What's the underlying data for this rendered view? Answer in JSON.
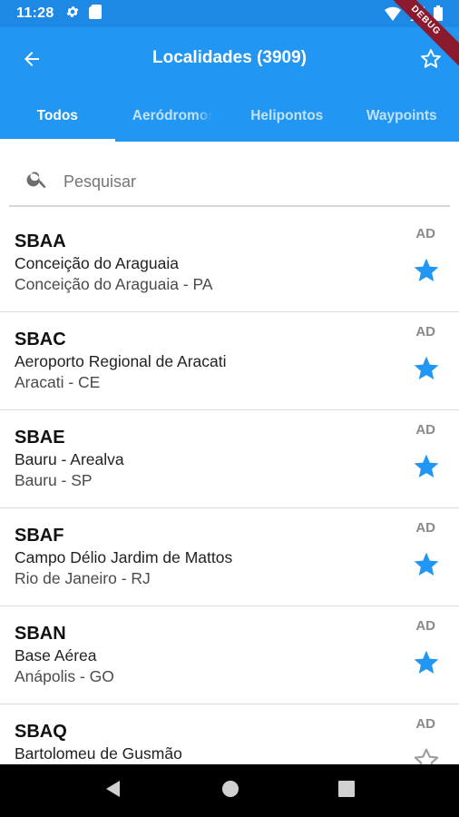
{
  "status_bar": {
    "time": "11:28",
    "debug_label": "DEBUG"
  },
  "app_bar": {
    "title": "Localidades (3909)"
  },
  "tabs": [
    {
      "label": "Todos",
      "active": true
    },
    {
      "label": "Aeródromos",
      "active": false
    },
    {
      "label": "Helipontos",
      "active": false
    },
    {
      "label": "Waypoints",
      "active": false
    }
  ],
  "search": {
    "placeholder": "Pesquisar",
    "value": ""
  },
  "locations": [
    {
      "code": "SBAA",
      "name": "Conceição do Araguaia",
      "city": "Conceição do Araguaia - PA",
      "type": "AD",
      "favorite": true
    },
    {
      "code": "SBAC",
      "name": "Aeroporto Regional de Aracati",
      "city": "Aracati - CE",
      "type": "AD",
      "favorite": true
    },
    {
      "code": "SBAE",
      "name": "Bauru - Arealva",
      "city": "Bauru - SP",
      "type": "AD",
      "favorite": true
    },
    {
      "code": "SBAF",
      "name": "Campo Délio Jardim de Mattos",
      "city": "Rio de Janeiro - RJ",
      "type": "AD",
      "favorite": true
    },
    {
      "code": "SBAN",
      "name": "Base Aérea",
      "city": "Anápolis - GO",
      "type": "AD",
      "favorite": true
    },
    {
      "code": "SBAQ",
      "name": "Bartolomeu de Gusmão",
      "city": "",
      "type": "AD",
      "favorite": false
    }
  ],
  "colors": {
    "primary": "#2196f3",
    "status_bar": "#1e88e5",
    "star": "#2196f3",
    "star_empty": "#9e9e9e"
  },
  "icons": {
    "back": "arrow-left-icon",
    "favorites": "star-outline-icon",
    "search": "search-icon",
    "star_filled": "star-filled-icon",
    "star_outline": "star-outline-icon"
  }
}
